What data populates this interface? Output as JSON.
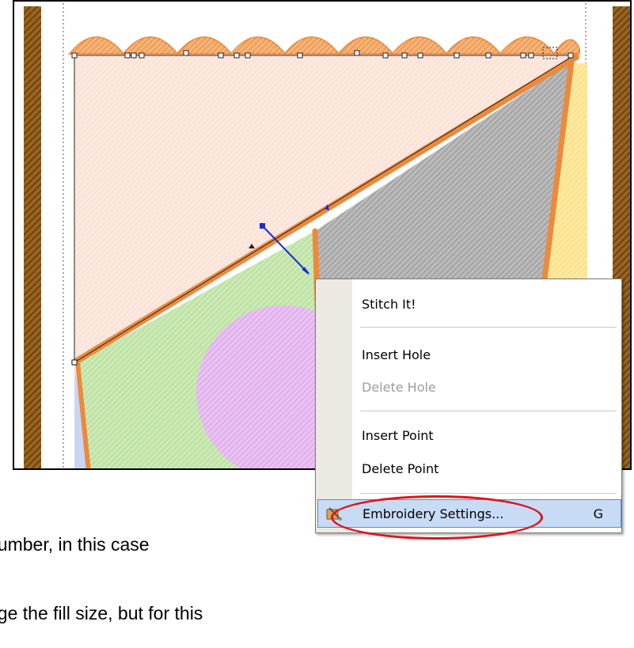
{
  "tutorial": {
    "line1": "number, in this case",
    "line2": "nge the fill size, but for this"
  },
  "context_menu": {
    "items": [
      {
        "label": "Stitch It!",
        "enabled": true
      },
      {
        "label": "Insert Hole",
        "enabled": true
      },
      {
        "label": "Delete Hole",
        "enabled": false
      },
      {
        "label": "Insert Point",
        "enabled": true
      },
      {
        "label": "Delete Point",
        "enabled": true
      },
      {
        "label": "Embroidery Settings...",
        "shortcut": "G",
        "enabled": true,
        "highlighted": true
      }
    ]
  },
  "colors": {
    "peach_fill": "#fbe3d8",
    "gray_fill": "#a9a9a9",
    "green_fill": "#bfe3a5",
    "purple_fill": "#e2b3ee",
    "yellow_fill": "#fbe38c",
    "blue_fill": "#c9d6f2",
    "orange_border": "#ec8a3c",
    "brown_strip": "#8b5a1d",
    "highlight_ellipse": "#e0141b"
  }
}
